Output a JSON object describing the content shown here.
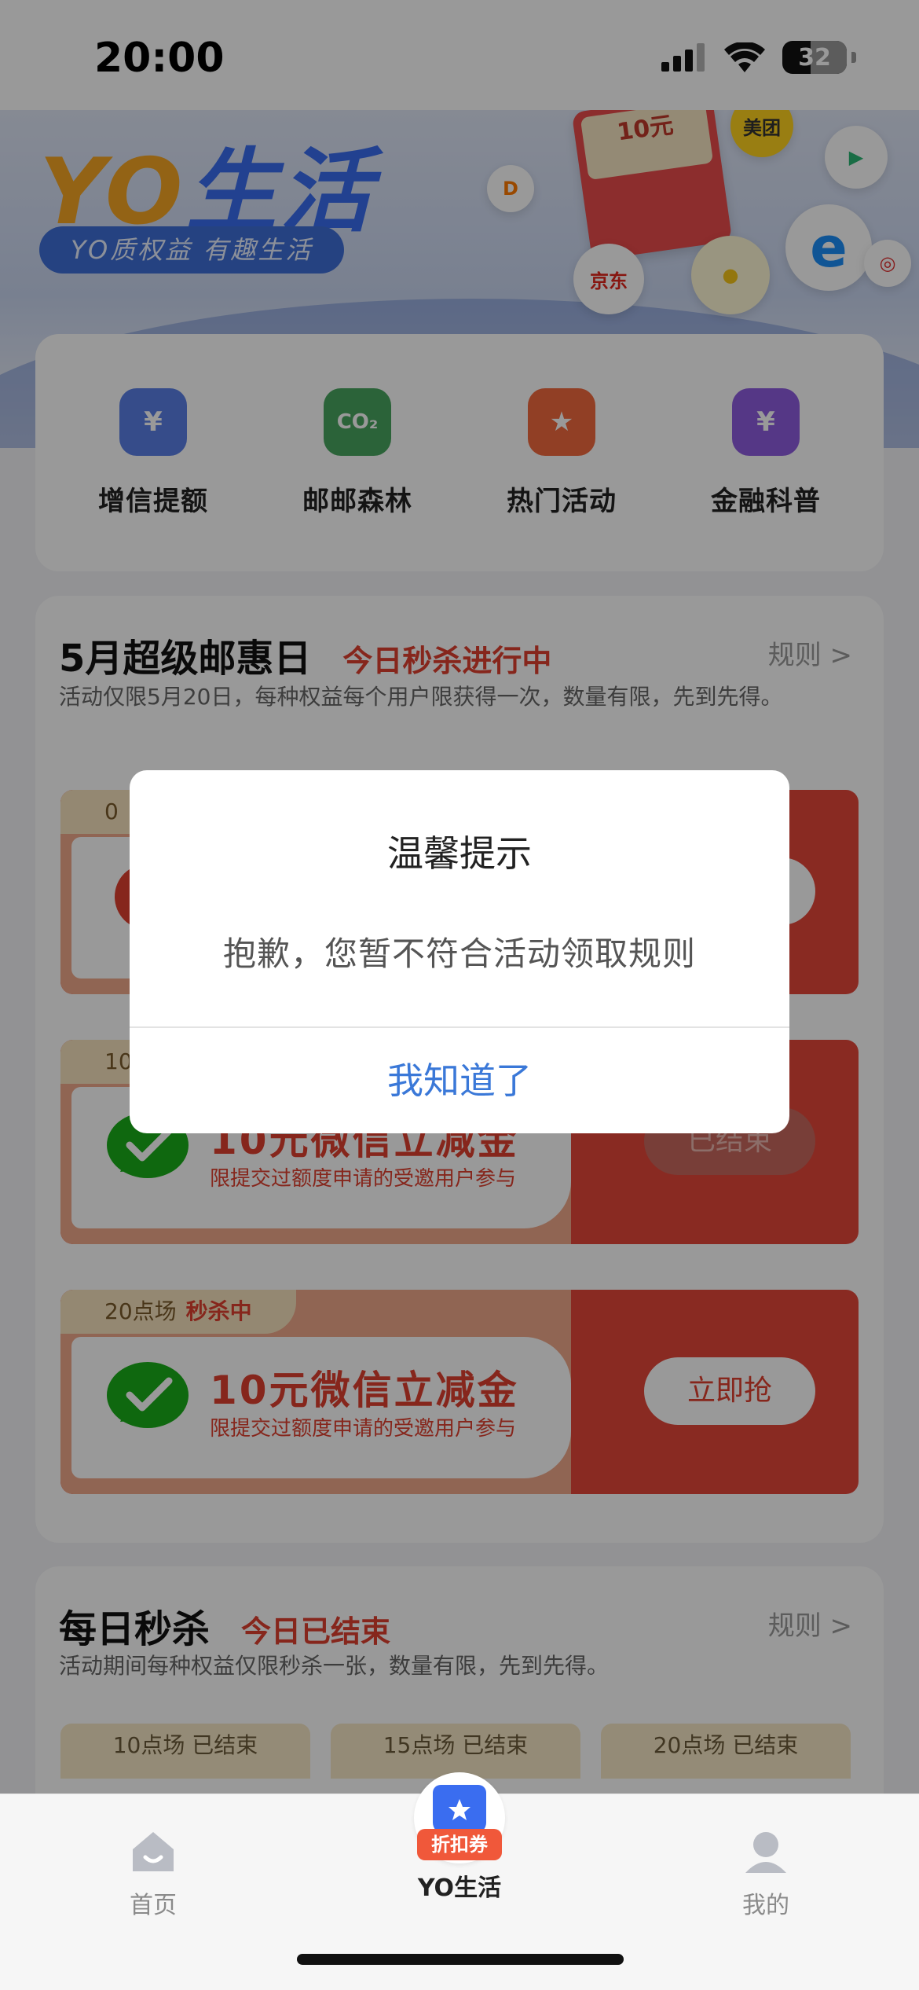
{
  "status_bar": {
    "time": "20:00",
    "battery": "32"
  },
  "banner": {
    "brand_yo": "YO",
    "brand_life": "生活",
    "slogan": "YO质权益 有趣生活",
    "coupon_art_amount": "10元",
    "bubbles": [
      "美团",
      "京东"
    ]
  },
  "quick_entries": [
    {
      "label": "增信提额",
      "icon": "wallet-yuan-icon",
      "color": "#5b7fe6"
    },
    {
      "label": "邮邮森林",
      "icon": "co2-cloud-icon",
      "color": "#49a65f"
    },
    {
      "label": "热门活动",
      "icon": "bookmark-star-icon",
      "color": "#f26a3f"
    },
    {
      "label": "金融科普",
      "icon": "document-search-icon",
      "color": "#8e5ce0"
    }
  ],
  "super_day": {
    "title": "5月超级邮惠日",
    "status": "今日秒杀进行中",
    "rule_link": "规则 >",
    "description": "活动仅限5月20日，每种权益每个用户限获得一次，数量有限，先到先得。",
    "coupons": [
      {
        "tag": "0",
        "tag_status": "",
        "name": "",
        "note": "",
        "button": ""
      },
      {
        "tag": "10",
        "tag_status": "",
        "name": "10元微信立减金",
        "note": "限提交过额度申请的受邀用户参与",
        "button": "已结束"
      },
      {
        "tag": "20点场",
        "tag_status": "秒杀中",
        "name": "10元微信立减金",
        "note": "限提交过额度申请的受邀用户参与",
        "button": "立即抢"
      }
    ]
  },
  "daily_flash": {
    "title": "每日秒杀",
    "status": "今日已结束",
    "rule_link": "规则 >",
    "description": "活动期间每种权益仅限秒杀一张，数量有限，先到先得。",
    "sessions": [
      "10点场 已结束",
      "15点场 已结束",
      "20点场 已结束"
    ]
  },
  "dialog": {
    "title": "温馨提示",
    "message": "抱歉，您暂不符合活动领取规则",
    "button": "我知道了"
  },
  "tab_bar": {
    "tabs": [
      {
        "label": "首页",
        "icon": "home-icon"
      },
      {
        "label": "YO生活",
        "icon": "shopping-bag-icon",
        "badge": "折扣券"
      },
      {
        "label": "我的",
        "icon": "profile-icon"
      }
    ],
    "active_index": 1
  },
  "colors": {
    "accent": "#3a78d8",
    "red": "#e0402f",
    "brand_blue": "#3a6df0"
  }
}
